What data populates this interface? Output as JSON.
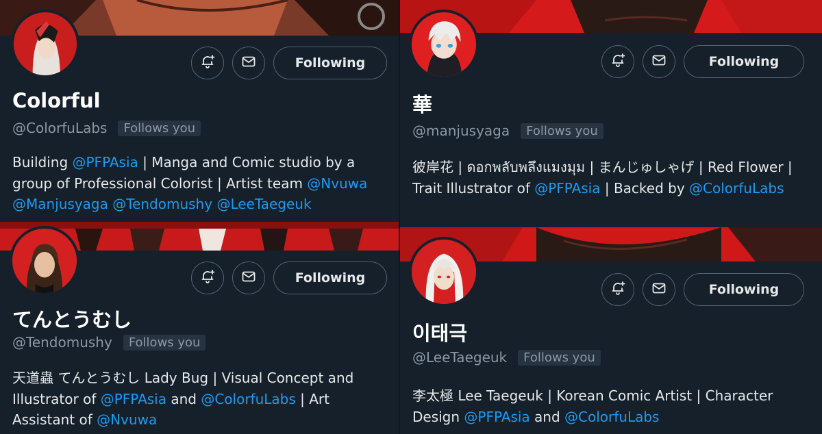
{
  "profiles": [
    {
      "display_name": "Colorful",
      "handle": "@ColorfuLabs",
      "follows_you": "Follows you",
      "following_label": "Following",
      "bio": [
        {
          "t": "Building "
        },
        {
          "t": "@PFPAsia",
          "m": true
        },
        {
          "t": " | Manga and Comic studio by a group of Professional Colorist | Artist team "
        },
        {
          "t": "@Nvuwa",
          "m": true
        },
        {
          "t": " "
        },
        {
          "t": "@Manjusyaga",
          "m": true
        },
        {
          "t": " "
        },
        {
          "t": "@Tendomushy",
          "m": true
        },
        {
          "t": " "
        },
        {
          "t": "@LeeTaegeuk",
          "m": true
        }
      ],
      "icons": {
        "notify": "bell-plus-icon",
        "message": "mail-icon"
      },
      "colors": {
        "banner": "#7a2a1e",
        "avatar": "#c81e1e"
      }
    },
    {
      "display_name": "華",
      "handle": "@manjusyaga",
      "follows_you": "Follows you",
      "following_label": "Following",
      "bio": [
        {
          "t": "彼岸花 | ดอกพลับพลึงแมงมุม | まんじゅしゃげ | Red Flower | Trait Illustrator of "
        },
        {
          "t": "@PFPAsia",
          "m": true
        },
        {
          "t": " | Backed by "
        },
        {
          "t": "@ColorfuLabs",
          "m": true
        }
      ],
      "icons": {
        "notify": "bell-plus-icon",
        "message": "mail-icon"
      },
      "colors": {
        "banner": "#d01818",
        "avatar": "#e02020"
      }
    },
    {
      "display_name": "てんとうむし",
      "handle": "@Tendomushy",
      "follows_you": "Follows you",
      "following_label": "Following",
      "bio": [
        {
          "t": "天道蟲 てんとうむし Lady Bug | Visual Concept and Illustrator of "
        },
        {
          "t": "@PFPAsia",
          "m": true
        },
        {
          "t": " and "
        },
        {
          "t": "@ColorfuLabs",
          "m": true
        },
        {
          "t": " | Art Assistant of "
        },
        {
          "t": "@Nvuwa",
          "m": true
        }
      ],
      "icons": {
        "notify": "bell-plus-icon",
        "message": "mail-icon"
      },
      "colors": {
        "banner": "#c81a1a",
        "avatar": "#d42020"
      }
    },
    {
      "display_name": "이태극",
      "handle": "@LeeTaegeuk",
      "follows_you": "Follows you",
      "following_label": "Following",
      "bio": [
        {
          "t": "李太極 Lee Taegeuk | Korean Comic Artist | Character Design "
        },
        {
          "t": "@PFPAsia",
          "m": true
        },
        {
          "t": " and "
        },
        {
          "t": "@ColorfuLabs",
          "m": true
        }
      ],
      "icons": {
        "notify": "bell-plus-icon",
        "message": "mail-icon"
      },
      "colors": {
        "banner": "#d01818",
        "avatar": "#d42020"
      }
    }
  ]
}
